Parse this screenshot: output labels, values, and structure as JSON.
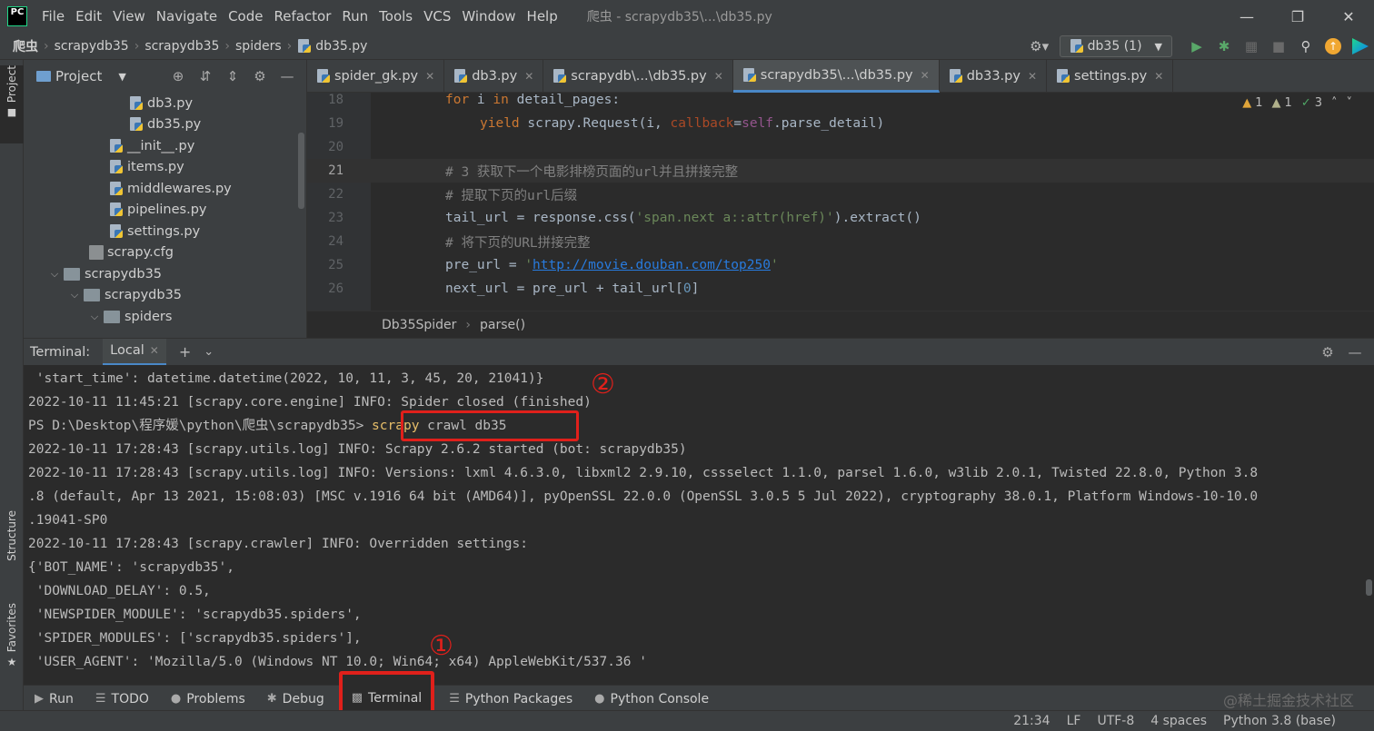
{
  "app": {
    "logo": "PC",
    "window_title": "爬虫 - scrapydb35\\...\\db35.py",
    "menu": [
      "File",
      "Edit",
      "View",
      "Navigate",
      "Code",
      "Refactor",
      "Run",
      "Tools",
      "VCS",
      "Window",
      "Help"
    ]
  },
  "navbar": {
    "crumbs": [
      "爬虫",
      "scrapydb35",
      "scrapydb35",
      "spiders",
      "db35.py"
    ],
    "run_config": "db35 (1)"
  },
  "left_strip": {
    "project": "Project",
    "structure": "Structure",
    "favorites": "Favorites"
  },
  "project": {
    "title": "Project",
    "tree": [
      {
        "label": "db3.py",
        "type": "py"
      },
      {
        "label": "db35.py",
        "type": "py"
      },
      {
        "label": "__init__.py",
        "type": "py"
      },
      {
        "label": "items.py",
        "type": "py"
      },
      {
        "label": "middlewares.py",
        "type": "py"
      },
      {
        "label": "pipelines.py",
        "type": "py"
      },
      {
        "label": "settings.py",
        "type": "py"
      },
      {
        "label": "scrapy.cfg",
        "type": "cfg"
      },
      {
        "label": "scrapydb35",
        "type": "folder"
      },
      {
        "label": "scrapydb35",
        "type": "folder"
      },
      {
        "label": "spiders",
        "type": "folder"
      }
    ]
  },
  "editor": {
    "tabs": [
      "spider_gk.py",
      "db3.py",
      "scrapydb\\...\\db35.py",
      "scrapydb35\\...\\db35.py",
      "db33.py",
      "settings.py"
    ],
    "active_tab": 3,
    "line_numbers": [
      "18",
      "19",
      "20",
      "21",
      "22",
      "23",
      "24",
      "25",
      "26"
    ],
    "inspections": {
      "warn1": "1",
      "warn2": "1",
      "ok": "3"
    },
    "code": {
      "l18_kw1": "for",
      "l18_mid": " i ",
      "l18_kw2": "in",
      "l18_rest": " detail_pages:",
      "l19_kw": "yield",
      "l19_a": " scrapy.Request(i, ",
      "l19_param": "callback",
      "l19_b": "=",
      "l19_self": "self",
      "l19_c": ".parse_detail)",
      "l21": "# 3 获取下一个电影排榜页面的url并且拼接完整",
      "l22": "# 提取下页的url后缀",
      "l23_a": "tail_url = response.css(",
      "l23_str": "'span.next a::attr(href)'",
      "l23_b": ").extract()",
      "l24": "# 将下页的URL拼接完整",
      "l25_a": "pre_url = ",
      "l25_q1": "'",
      "l25_url": "http://movie.douban.com/top250",
      "l25_q2": "'",
      "l26_a": "next_url = pre_url + tail_url[",
      "l26_num": "0",
      "l26_b": "]"
    },
    "crumb": [
      "Db35Spider",
      "parse()"
    ]
  },
  "terminal": {
    "title": "Terminal:",
    "tab": "Local",
    "lines": {
      "l1": " 'start_time': datetime.datetime(2022, 10, 11, 3, 45, 20, 21041)}",
      "l2": "2022-10-11 11:45:21 [scrapy.core.engine] INFO: Spider closed (finished)",
      "l3_prompt": "PS D:\\Desktop\\程序媛\\python\\爬虫\\scrapydb35> ",
      "l3_cmd1": "scrapy",
      "l3_cmd2": " crawl db35",
      "l4": "2022-10-11 17:28:43 [scrapy.utils.log] INFO: Scrapy 2.6.2 started (bot: scrapydb35)",
      "l5": "2022-10-11 17:28:43 [scrapy.utils.log] INFO: Versions: lxml 4.6.3.0, libxml2 2.9.10, cssselect 1.1.0, parsel 1.6.0, w3lib 2.0.1, Twisted 22.8.0, Python 3.8",
      "l6": ".8 (default, Apr 13 2021, 15:08:03) [MSC v.1916 64 bit (AMD64)], pyOpenSSL 22.0.0 (OpenSSL 3.0.5 5 Jul 2022), cryptography 38.0.1, Platform Windows-10-10.0",
      "l7": ".19041-SP0",
      "l8": "2022-10-11 17:28:43 [scrapy.crawler] INFO: Overridden settings:",
      "l9": "{'BOT_NAME': 'scrapydb35',",
      "l10": " 'DOWNLOAD_DELAY': 0.5,",
      "l11": " 'NEWSPIDER_MODULE': 'scrapydb35.spiders',",
      "l12": " 'SPIDER_MODULES': ['scrapydb35.spiders'],",
      "l13": " 'USER_AGENT': 'Mozilla/5.0 (Windows NT 10.0; Win64; x64) AppleWebKit/537.36 '"
    },
    "annotation_1": "①",
    "annotation_2": "②"
  },
  "bottom_tools": [
    "Run",
    "TODO",
    "Problems",
    "Debug",
    "Terminal",
    "Python Packages",
    "Python Console"
  ],
  "status": [
    "21:34",
    "LF",
    "UTF-8",
    "4 spaces",
    "Python 3.8 (base)"
  ],
  "watermark": "@稀土掘金技术社区",
  "colors": {
    "accent": "#4a88c7",
    "annotation_red": "#e0201b",
    "background": "#2b2b2b",
    "panel": "#3c3f41"
  }
}
